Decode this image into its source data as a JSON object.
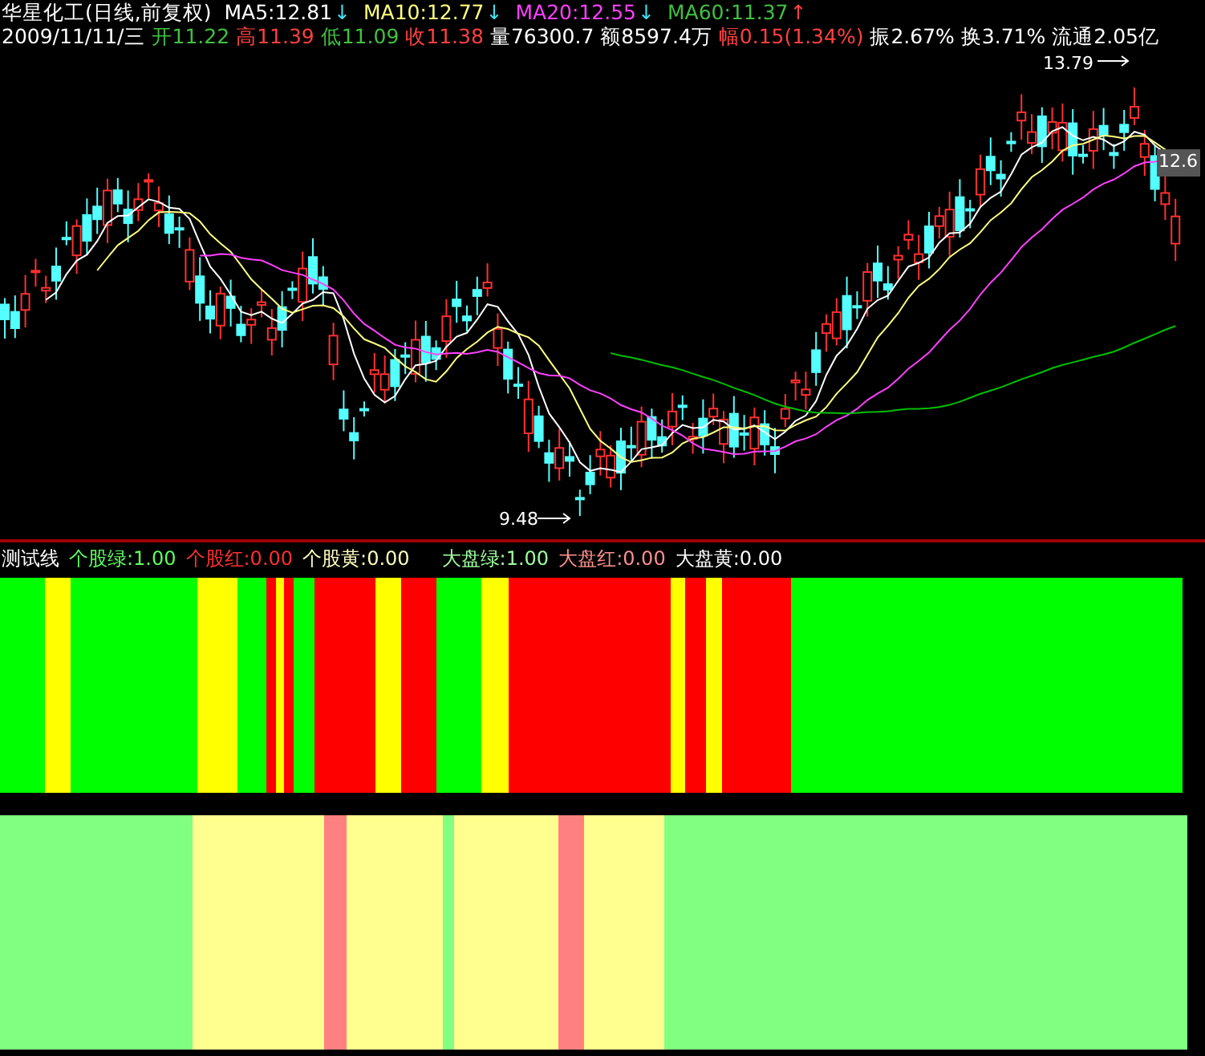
{
  "header": {
    "title": "华星化工(日线,前复权)",
    "moving_averages": [
      {
        "label": "MA5:12.81",
        "arrow": "↓",
        "rising": false,
        "color": "#ffffff"
      },
      {
        "label": "MA10:12.77",
        "arrow": "↓",
        "rising": false,
        "color": "#ffff80"
      },
      {
        "label": "MA20:12.55",
        "arrow": "↓",
        "rising": false,
        "color": "#ff40ff"
      },
      {
        "label": "MA60:11.37",
        "arrow": "↑",
        "rising": true,
        "color": "#40c040"
      }
    ],
    "quote": [
      {
        "text": "2009/11/11/三",
        "color": "#ffffff"
      },
      {
        "text": "开11.22",
        "color": "#40c040"
      },
      {
        "text": "高11.39",
        "color": "#ff4040"
      },
      {
        "text": "低11.09",
        "color": "#40c040"
      },
      {
        "text": "收11.38",
        "color": "#ff4040"
      },
      {
        "text": "量76300.7",
        "color": "#ffffff"
      },
      {
        "text": "额8597.4万",
        "color": "#ffffff"
      },
      {
        "text": "幅0.15(1.34%)",
        "color": "#ff4040"
      },
      {
        "text": "振2.67%",
        "color": "#ffffff"
      },
      {
        "text": "换3.71%",
        "color": "#ffffff"
      },
      {
        "text": "流通2.05亿",
        "color": "#ffffff"
      }
    ]
  },
  "chart": {
    "high_label": "13.79",
    "low_label": "9.48",
    "last_label": "12.6"
  },
  "indicator": {
    "title": "测试线",
    "values": [
      {
        "text": "个股绿:1.00",
        "color": "#60ff60"
      },
      {
        "text": "个股红:0.00",
        "color": "#ff3030"
      },
      {
        "text": "个股黄:0.00",
        "color": "#ffffc0"
      },
      {
        "text": "大盘绿:1.00",
        "color": "#a0ffa0"
      },
      {
        "text": "大盘红:0.00",
        "color": "#ff9090"
      },
      {
        "text": "大盘黄:0.00",
        "color": "#ffffff"
      }
    ]
  }
}
